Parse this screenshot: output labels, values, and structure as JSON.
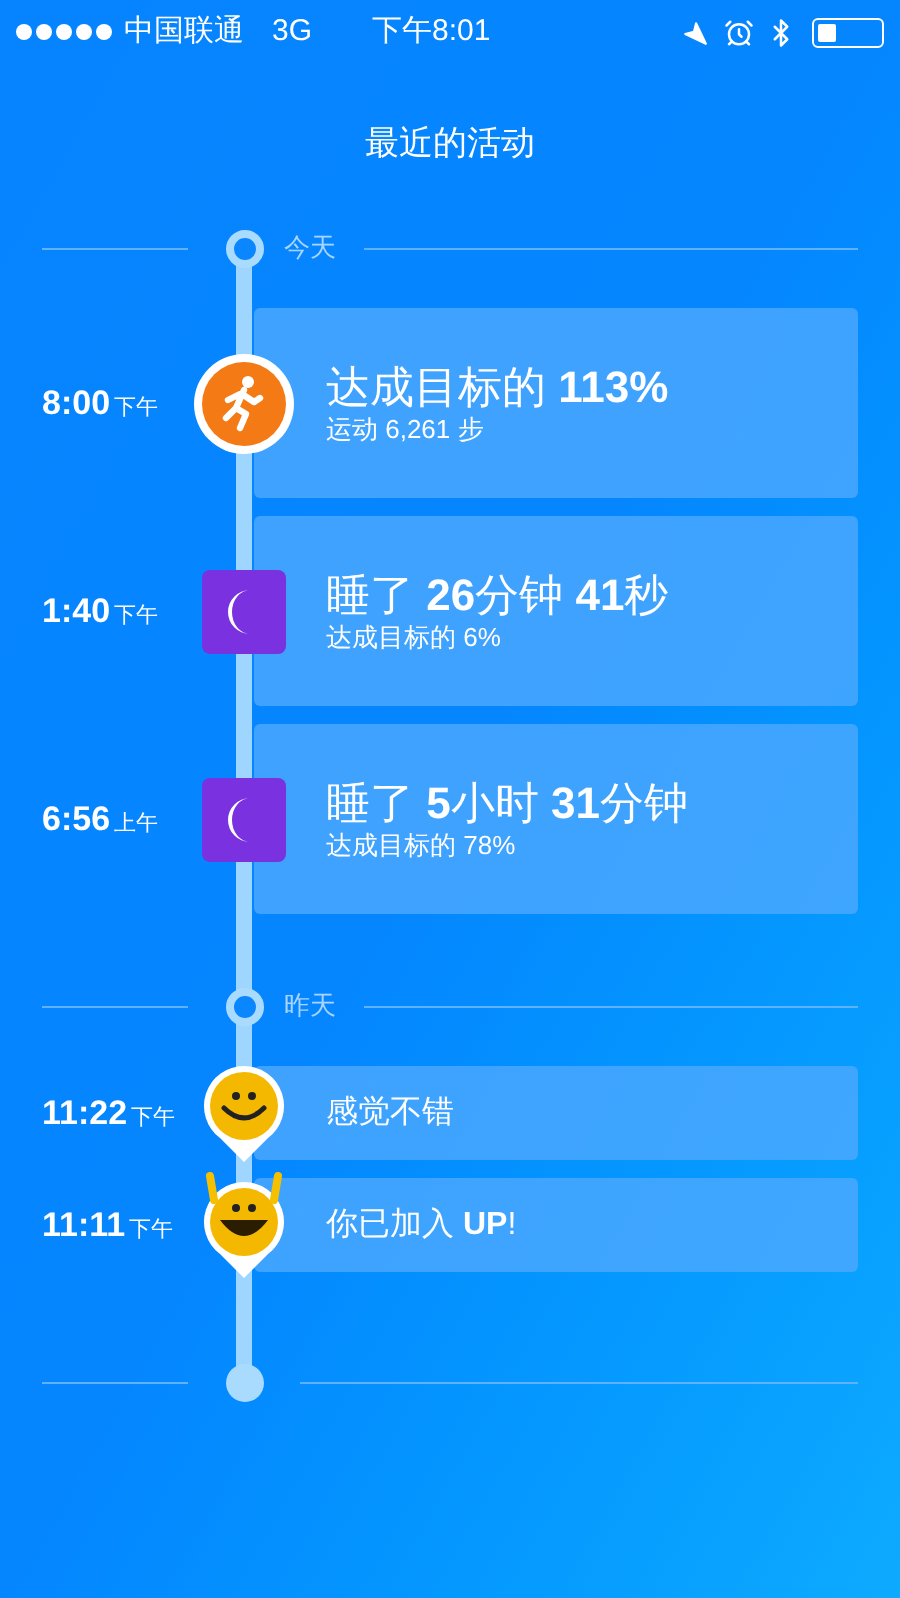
{
  "status_bar": {
    "carrier": "中国联通",
    "network": "3G",
    "time": "下午8:01"
  },
  "title": "最近的活动",
  "sections": [
    {
      "label": "今天",
      "entries": [
        {
          "kind": "run",
          "time": "8:00",
          "period": "下午",
          "title": "达成目标的 **113%**",
          "subtitle": "运动 6,261 步"
        },
        {
          "kind": "sleep",
          "time": "1:40",
          "period": "下午",
          "title": "睡了 **26**分钟 **41**秒",
          "subtitle": "达成目标的 6%"
        },
        {
          "kind": "sleep",
          "time": "6:56",
          "period": "上午",
          "title": "睡了 **5**小时 **31**分钟",
          "subtitle": "达成目标的 78%"
        }
      ]
    },
    {
      "label": "昨天",
      "entries": [
        {
          "kind": "mood_smile",
          "time": "11:22",
          "period": "下午",
          "title": "感觉不错"
        },
        {
          "kind": "mood_cheer",
          "time": "11:11",
          "period": "下午",
          "title": "你已加入 **UP**!"
        }
      ]
    }
  ]
}
